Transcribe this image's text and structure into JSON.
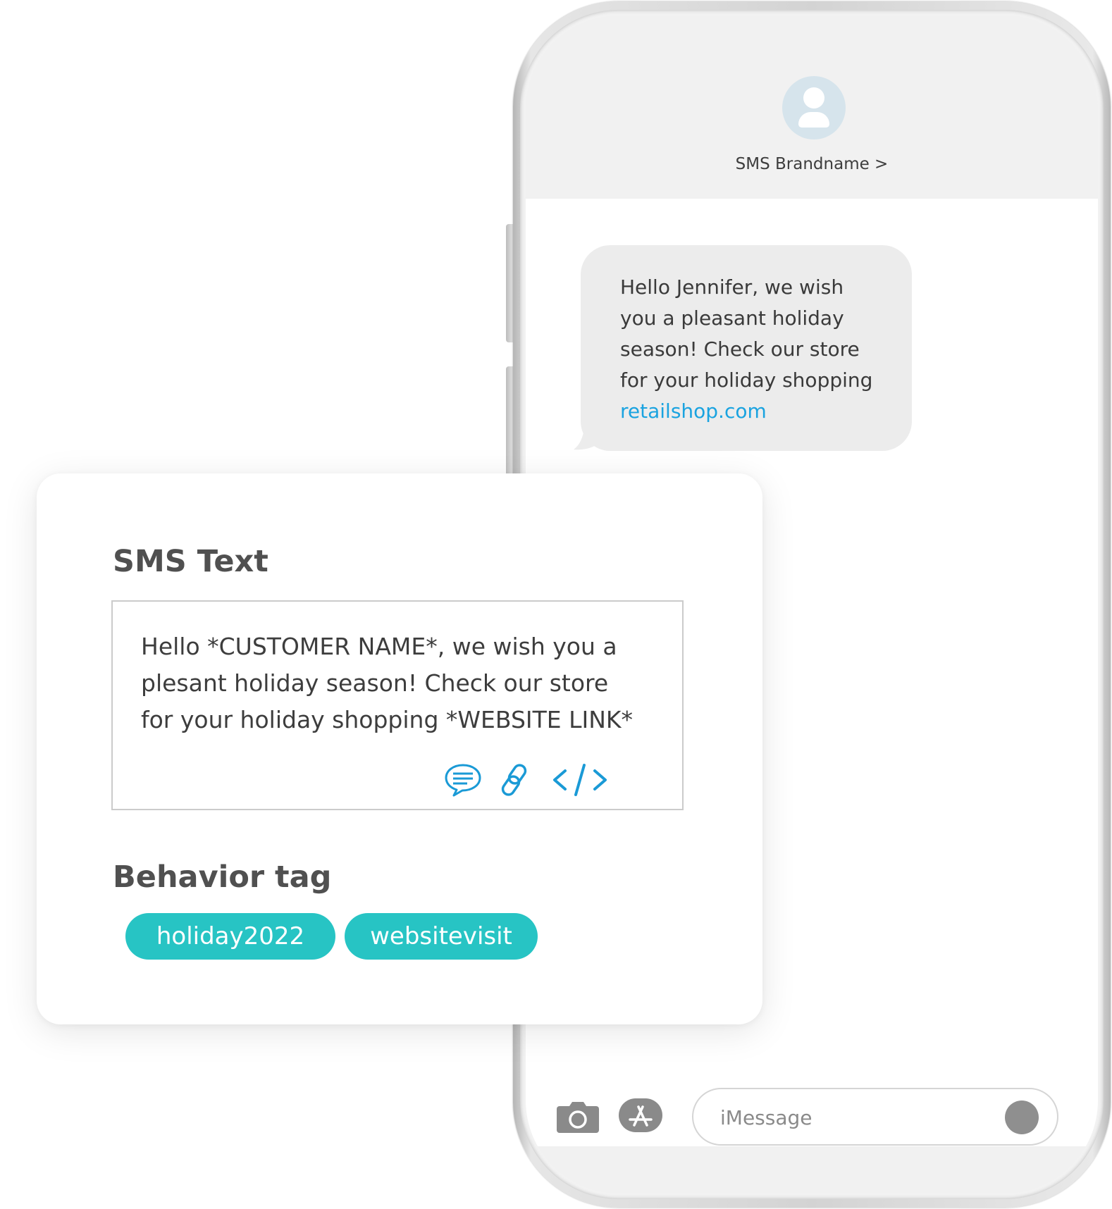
{
  "phone": {
    "contact_name": "SMS Brandname >",
    "message": {
      "lines": [
        "Hello Jennifer, we wish",
        "you a pleasant holiday",
        "season! Check our store",
        "for your holiday shopping"
      ],
      "link": "retailshop.com"
    },
    "compose": {
      "placeholder": "iMessage"
    }
  },
  "card": {
    "sms_heading": "SMS Text",
    "sms_template_lines": [
      "Hello *CUSTOMER NAME*, we wish you a",
      "plesant holiday season! Check our store",
      "for your holiday shopping *WEBSITE LINK*"
    ],
    "behavior_heading": "Behavior tag",
    "tags": [
      "holiday2022",
      "websitevisit"
    ]
  },
  "colors": {
    "link": "#1aa3e0",
    "icon_blue": "#1a9ad6",
    "tag_background": "#27c4c4",
    "avatar_background": "#d6e4ec"
  },
  "icons": {
    "avatar": "person-icon",
    "camera": "camera-icon",
    "apps": "app-store-icon",
    "chat": "chat-bubble-icon",
    "link": "link-icon",
    "code": "code-icon"
  }
}
